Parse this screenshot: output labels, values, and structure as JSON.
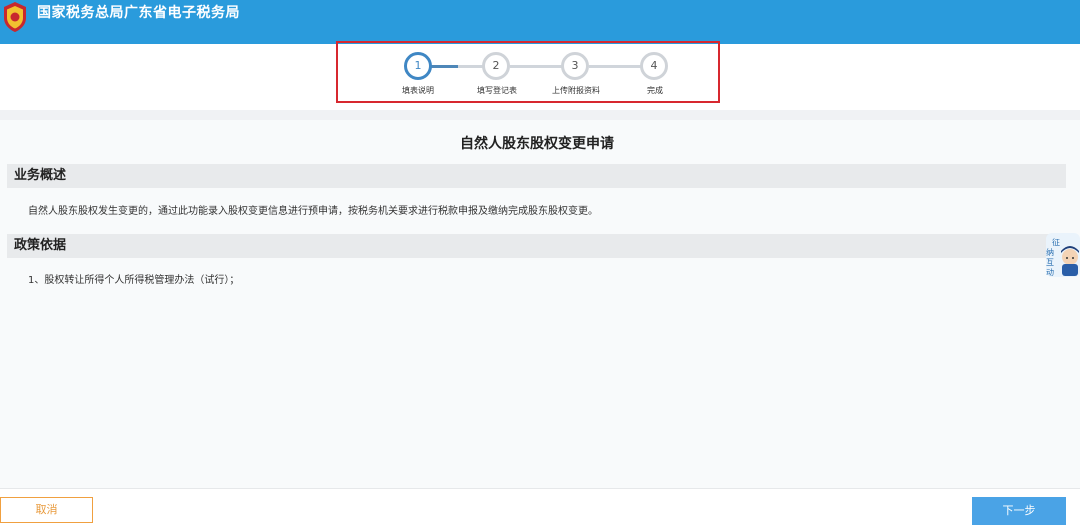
{
  "header": {
    "title": "国家税务总局广东省电子税务局",
    "logo_icon": "tax-emblem-icon"
  },
  "steps": [
    {
      "number": "1",
      "label": "填表说明",
      "state": "active"
    },
    {
      "number": "2",
      "label": "填写登记表",
      "state": "pending"
    },
    {
      "number": "3",
      "label": "上传附报资料",
      "state": "pending"
    },
    {
      "number": "4",
      "label": "完成",
      "state": "pending"
    }
  ],
  "page": {
    "title": "自然人股东股权变更申请"
  },
  "sections": {
    "overview": {
      "heading": "业务概述",
      "text": "自然人股东股权发生变更的，通过此功能录入股权变更信息进行预申请，按税务机关要求进行税款申报及缴纳完成股东股权变更。"
    },
    "policy": {
      "heading": "政策依据",
      "text": "1、股权转让所得个人所得税管理办法（试行）；"
    }
  },
  "float_widget": {
    "icon": "tax-interaction-mascot-icon",
    "label_lines": [
      "征",
      "纳",
      "互",
      "动"
    ]
  },
  "footer": {
    "cancel_label": "取消",
    "next_label": "下一步"
  },
  "colors": {
    "header_bg": "#2a9bdc",
    "active_step": "#3f87c4",
    "highlight_box": "#d7282f",
    "cancel": "#e89a3c",
    "next_bg": "#4aa3e6"
  }
}
